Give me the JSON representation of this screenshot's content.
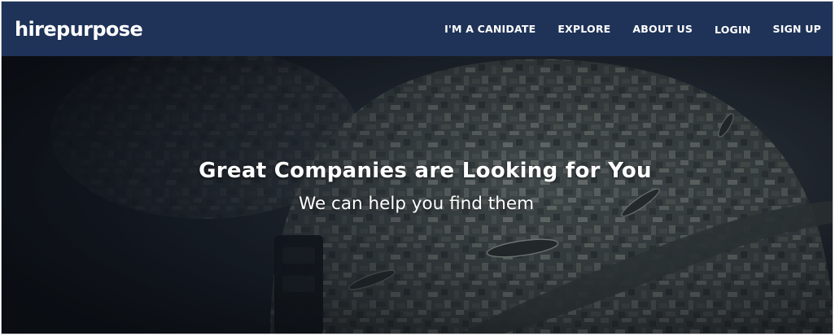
{
  "brand": {
    "logo_text": "hirepurpose"
  },
  "nav": {
    "items": [
      {
        "label": "I'M A CANIDATE"
      },
      {
        "label": "EXPLORE"
      },
      {
        "label": "ABOUT US"
      },
      {
        "label": "LOGIN"
      },
      {
        "label": "SIGN UP"
      }
    ]
  },
  "hero": {
    "title": "Great Companies are Looking for You",
    "subtitle": "We can help you find them",
    "image_subject": "camouflage-military-helmet"
  },
  "colors": {
    "navbar": "#1f3358",
    "text": "#ffffff",
    "hero_dark": "#1b2029"
  }
}
